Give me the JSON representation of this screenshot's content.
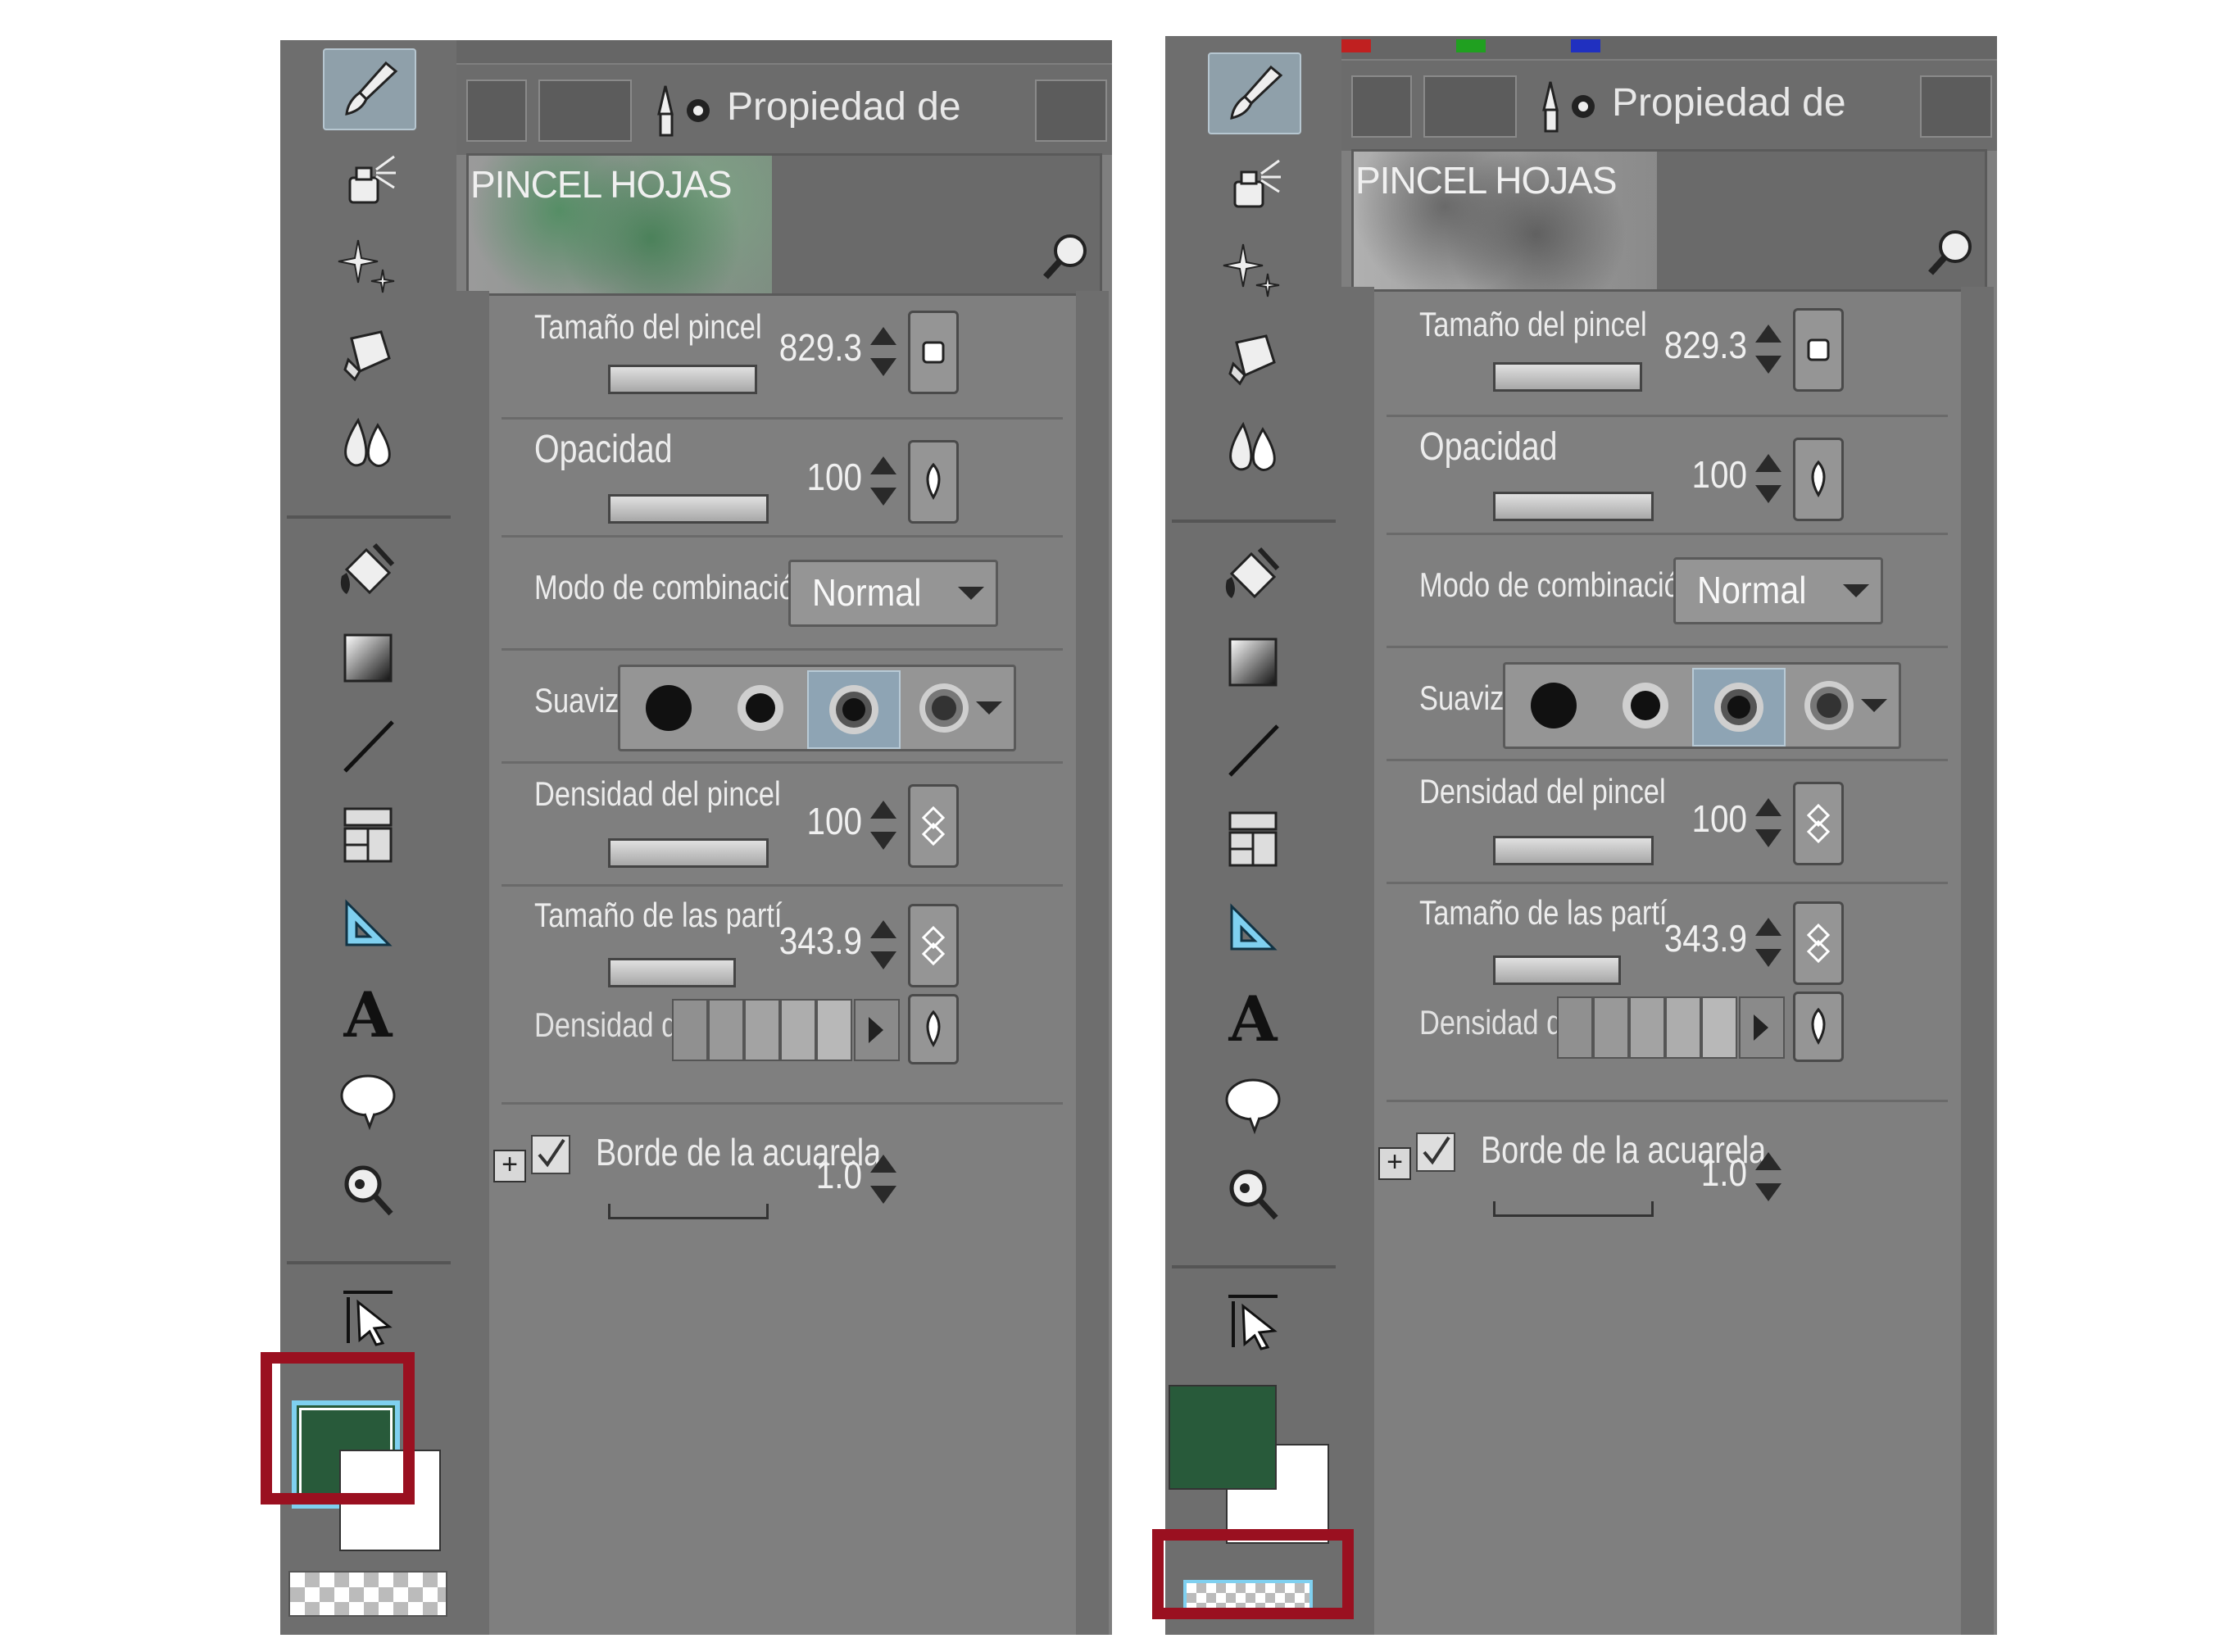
{
  "panels": [
    {
      "id": "a",
      "tab_title": "Propiedad de",
      "subtool_name": "PINCEL HOJAS",
      "properties": {
        "brush_size": {
          "label": "Tamaño del pincel",
          "value": "829.3"
        },
        "opacity": {
          "label": "Opacidad",
          "value": "100"
        },
        "blend_mode": {
          "label": "Modo de combinación",
          "value": "Normal"
        },
        "anti_alias": {
          "label": "Suaviz"
        },
        "brush_density": {
          "label": "Densidad del pincel",
          "value": "100"
        },
        "particle_size": {
          "label": "Tamaño de las partí",
          "value": "343.9"
        },
        "particle_density": {
          "label": "Densidad d"
        },
        "watercolor_edge": {
          "label": "Borde de la acuarela",
          "value": "1.0",
          "checked": true
        }
      },
      "colors": {
        "main": "#285a3a",
        "sub": "#ffffff"
      },
      "highlight_target": "main-color"
    },
    {
      "id": "b",
      "tab_title": "Propiedad de",
      "subtool_name": "PINCEL HOJAS",
      "properties": {
        "brush_size": {
          "label": "Tamaño del pincel",
          "value": "829.3"
        },
        "opacity": {
          "label": "Opacidad",
          "value": "100"
        },
        "blend_mode": {
          "label": "Modo de combinación",
          "value": "Normal"
        },
        "anti_alias": {
          "label": "Suaviz"
        },
        "brush_density": {
          "label": "Densidad del pincel",
          "value": "100"
        },
        "particle_size": {
          "label": "Tamaño de las partí",
          "value": "343.9"
        },
        "particle_density": {
          "label": "Densidad d"
        },
        "watercolor_edge": {
          "label": "Borde de la acuarela",
          "value": "1.0",
          "checked": true
        }
      },
      "colors": {
        "main": "#285a3a",
        "sub": "#ffffff"
      },
      "highlight_target": "transparent-color"
    }
  ],
  "toolbar_icons": [
    "brush-tool-icon",
    "airbrush-tool-icon",
    "decoration-tool-icon",
    "eraser-tool-icon",
    "blend-tool-icon",
    "fill-tool-icon",
    "gradient-tool-icon",
    "figure-tool-icon",
    "frame-border-tool-icon",
    "ruler-tool-icon",
    "text-tool-icon",
    "balloon-tool-icon",
    "correct-line-tool-icon",
    "operation-tool-icon"
  ],
  "highlight_color": "#9a1020"
}
